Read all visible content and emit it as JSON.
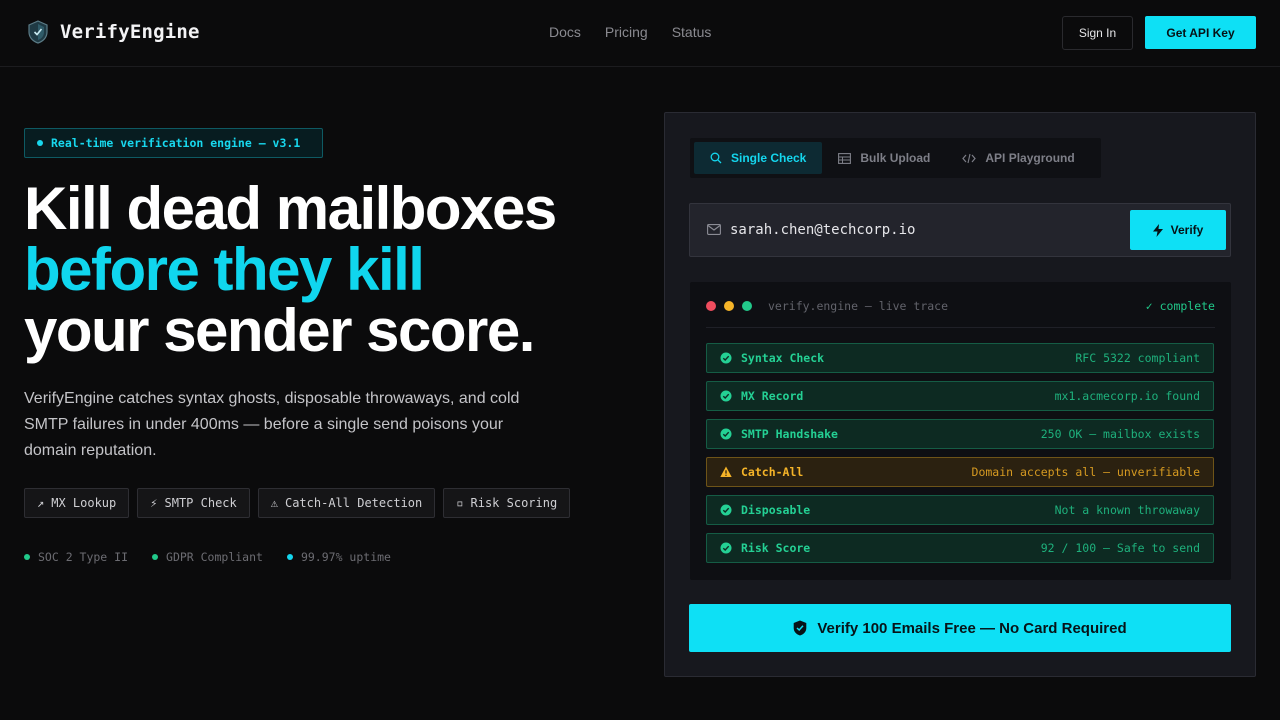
{
  "brand": {
    "name": "VerifyEngine",
    "logo_icon": "shield-logo-icon"
  },
  "nav": {
    "items": [
      "Docs",
      "Pricing",
      "Status"
    ]
  },
  "header": {
    "signin_label": "Sign In",
    "apikey_label": "Get API Key"
  },
  "hero": {
    "badge": "Real-time verification engine — v3.1",
    "headline_line1": "Kill dead mailboxes",
    "headline_line2": "before they kill",
    "headline_line3": "your sender score.",
    "subtext": "VerifyEngine catches syntax ghosts, disposable throwaways, and cold SMTP failures in under 400ms — before a single send poisons your domain reputation.",
    "chips": [
      {
        "icon": "↗",
        "label": "MX Lookup"
      },
      {
        "icon": "⚡",
        "label": "SMTP Check"
      },
      {
        "icon": "⚠",
        "label": "Catch-All Detection"
      },
      {
        "icon": "▫",
        "label": "Risk Scoring"
      }
    ],
    "trust": [
      {
        "label": "SOC 2 Type II",
        "color": "#21c98a"
      },
      {
        "label": "GDPR Compliant",
        "color": "#21c98a"
      },
      {
        "label": "99.97% uptime",
        "color": "#14d6ee"
      }
    ]
  },
  "card": {
    "tabs": [
      {
        "label": "Single Check",
        "icon": "search-icon",
        "active": true
      },
      {
        "label": "Bulk Upload",
        "icon": "table-icon",
        "active": false
      },
      {
        "label": "API Playground",
        "icon": "code-icon",
        "active": false
      }
    ],
    "email_value": "sarah.chen@techcorp.io",
    "verify_label": "Verify",
    "trace": {
      "title": "verify.engine — live trace",
      "status": "✓ complete",
      "rows": [
        {
          "label": "Syntax Check",
          "value": "RFC 5322 compliant",
          "state": "ok"
        },
        {
          "label": "MX Record",
          "value": "mx1.acmecorp.io found",
          "state": "ok"
        },
        {
          "label": "SMTP Handshake",
          "value": "250 OK — mailbox exists",
          "state": "ok"
        },
        {
          "label": "Catch-All",
          "value": "Domain accepts all — unverifiable",
          "state": "warn"
        },
        {
          "label": "Disposable",
          "value": "Not a known throwaway",
          "state": "ok"
        },
        {
          "label": "Risk Score",
          "value": "92 / 100 — Safe to send",
          "state": "ok"
        }
      ]
    },
    "cta_label": "Verify 100 Emails Free — No Card Required"
  },
  "colors": {
    "accent": "#0ee0f5",
    "ok": "#24d094",
    "warn": "#f5b428",
    "background": "#0b0b0c"
  }
}
